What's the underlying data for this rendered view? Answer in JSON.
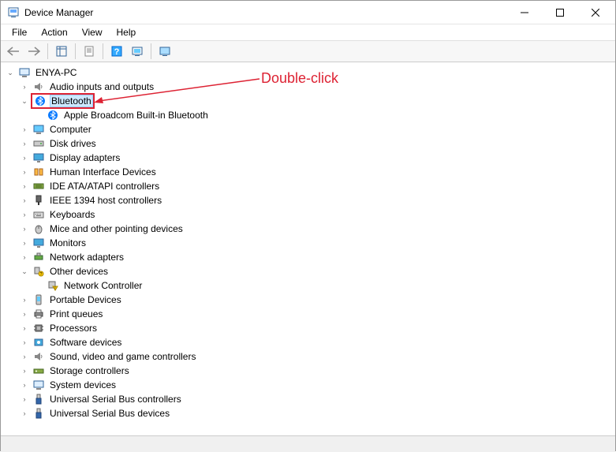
{
  "window": {
    "title": "Device Manager"
  },
  "menus": {
    "file": "File",
    "action": "Action",
    "view": "View",
    "help": "Help"
  },
  "annotation": {
    "text": "Double-click"
  },
  "tree": {
    "root": "ENYA-PC",
    "audio": "Audio inputs and outputs",
    "bluetooth": "Bluetooth",
    "bluetooth_child": "Apple Broadcom Built-in Bluetooth",
    "computer": "Computer",
    "disk": "Disk drives",
    "display": "Display adapters",
    "hid": "Human Interface Devices",
    "ide": "IDE ATA/ATAPI controllers",
    "ieee": "IEEE 1394 host controllers",
    "keyboards": "Keyboards",
    "mice": "Mice and other pointing devices",
    "monitors": "Monitors",
    "network": "Network adapters",
    "other": "Other devices",
    "other_child": "Network Controller",
    "portable": "Portable Devices",
    "print": "Print queues",
    "processors": "Processors",
    "software": "Software devices",
    "sound": "Sound, video and game controllers",
    "storage": "Storage controllers",
    "system": "System devices",
    "usb": "Universal Serial Bus controllers",
    "usbdev": "Universal Serial Bus devices"
  }
}
